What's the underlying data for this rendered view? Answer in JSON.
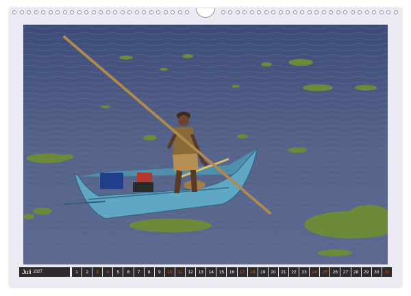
{
  "calendar": {
    "month": "Juli",
    "year": "2027",
    "days": [
      "1",
      "2",
      "3",
      "4",
      "5",
      "6",
      "7",
      "8",
      "9",
      "10",
      "11",
      "12",
      "13",
      "14",
      "15",
      "16",
      "17",
      "18",
      "19",
      "20",
      "21",
      "22",
      "23",
      "24",
      "25",
      "26",
      "27",
      "28",
      "29",
      "30",
      "31"
    ],
    "weekend_days": [
      "3",
      "4",
      "10",
      "11",
      "17",
      "18",
      "24",
      "25",
      "31"
    ]
  },
  "photo": {
    "scene": "fisherman-poling-boat"
  },
  "colors": {
    "sheet": "#ebeaf2",
    "strip": "#2b2b2b",
    "weekend": "#e2572c",
    "water": "#4a5a80",
    "boat": "#5fa7c4"
  }
}
